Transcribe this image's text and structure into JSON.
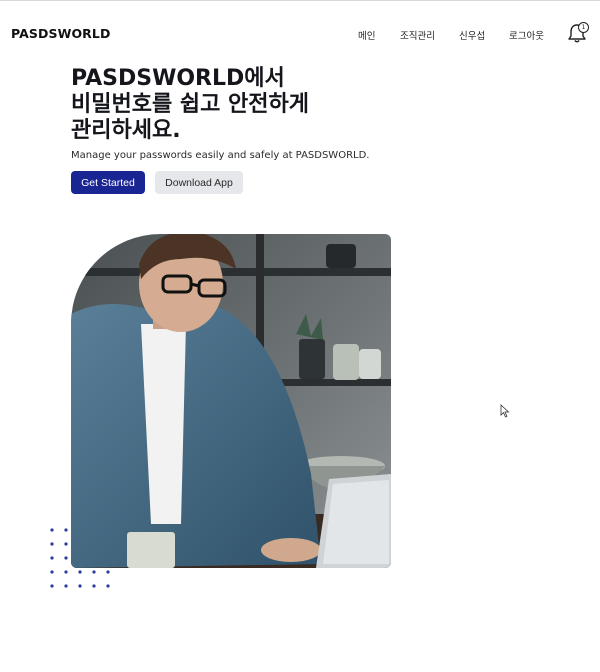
{
  "header": {
    "brand": "PASDSWORLD",
    "nav": [
      "메인",
      "조직관리",
      "신우섭",
      "로그아웃"
    ],
    "notification_icon": "bell-icon",
    "notification_count": "1"
  },
  "hero": {
    "title_lines": [
      "PASDSWORLD에서",
      "비밀번호를 쉽고 안전하게",
      "관리하세요."
    ],
    "subtitle": "Manage your passwords easily and safely at PASDSWORLD.",
    "primary_button": "Get Started",
    "secondary_button": "Download App"
  },
  "colors": {
    "accent": "#1a2594",
    "secondary_button_bg": "#e6e7eb",
    "dots": "#2b3aa0"
  },
  "image": {
    "subject": "man with glasses in denim shirt working on a laptop"
  }
}
